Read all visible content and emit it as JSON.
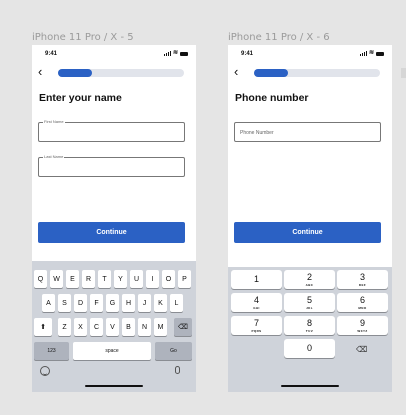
{
  "screens": [
    {
      "frame_label": "iPhone 11 Pro / X - 5",
      "status": {
        "time": "9:41"
      },
      "back_label": "‹",
      "progress": 0.27,
      "title": "Enter your name",
      "fields": [
        {
          "label": "First Name",
          "value": ""
        },
        {
          "label": "Last Name",
          "value": ""
        }
      ],
      "cta_label": "Continue",
      "keyboard": {
        "row1": [
          "Q",
          "W",
          "E",
          "R",
          "T",
          "Y",
          "U",
          "I",
          "O",
          "P"
        ],
        "row2": [
          "A",
          "S",
          "D",
          "F",
          "G",
          "H",
          "J",
          "K",
          "L"
        ],
        "row3": [
          "Z",
          "X",
          "C",
          "V",
          "B",
          "N",
          "M"
        ],
        "shift": "⬆",
        "delete": "⌫",
        "numbers": "123",
        "space": "space",
        "go": "Go"
      }
    },
    {
      "frame_label": "iPhone 11 Pro / X - 6",
      "status": {
        "time": "9:41"
      },
      "back_label": "‹",
      "progress": 0.27,
      "title": "Phone number",
      "fields": [
        {
          "label": "",
          "placeholder": "Phone Number",
          "value": ""
        }
      ],
      "cta_label": "Continue",
      "numpad": {
        "keys": [
          {
            "digit": "1",
            "letters": ""
          },
          {
            "digit": "2",
            "letters": "ABC"
          },
          {
            "digit": "3",
            "letters": "DEF"
          },
          {
            "digit": "4",
            "letters": "GHI"
          },
          {
            "digit": "5",
            "letters": "JKL"
          },
          {
            "digit": "6",
            "letters": "MNO"
          },
          {
            "digit": "7",
            "letters": "PQRS"
          },
          {
            "digit": "8",
            "letters": "TUV"
          },
          {
            "digit": "9",
            "letters": "WXYZ"
          },
          {
            "digit": "0",
            "letters": ""
          }
        ],
        "delete": "⌫"
      }
    }
  ],
  "colors": {
    "accent": "#2b61c4",
    "track": "#e1e4eb",
    "keyboard_bg": "#cfd3da",
    "canvas": "#e5e5e5"
  }
}
